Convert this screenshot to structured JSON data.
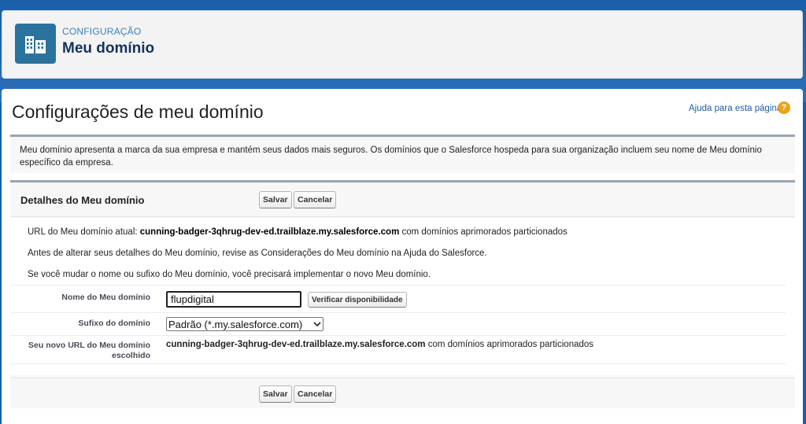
{
  "header": {
    "eyebrow": "CONFIGURAÇÃO",
    "title": "Meu domínio",
    "icon": "building-icon"
  },
  "page": {
    "title": "Configurações de meu domínio",
    "help_link": "Ajuda para esta página",
    "description": "Meu domínio apresenta a marca da sua empresa e mantém seus dados mais seguros. Os domínios que o Salesforce hospeda para sua organização incluem seu nome de Meu domínio específico da empresa."
  },
  "details": {
    "title": "Detalhes do Meu domínio",
    "save_label": "Salvar",
    "cancel_label": "Cancelar",
    "current_url_prefix": "URL do Meu domínio atual: ",
    "current_url": "cunning-badger-3qhrug-dev-ed.trailblaze.my.salesforce.com",
    "current_url_suffix": " com domínios aprimorados particionados",
    "note1": "Antes de alterar seus detalhes do Meu domínio, revise as Considerações do Meu domínio na Ajuda do Salesforce.",
    "note2": "Se você mudar o nome ou sufixo do Meu domínio, você precisará implementar o novo Meu domínio.",
    "name_label": "Nome do Meu domínio",
    "name_value": "flupdigital",
    "check_label": "Verificar disponibilidade",
    "suffix_label": "Sufixo do domínio",
    "suffix_value": "Padrão (*.my.salesforce.com)",
    "new_url_label": "Seu novo URL do Meu domínio escolhido",
    "new_url": "cunning-badger-3qhrug-dev-ed.trailblaze.my.salesforce.com",
    "new_url_suffix": " com domínios aprimorados particionados"
  }
}
